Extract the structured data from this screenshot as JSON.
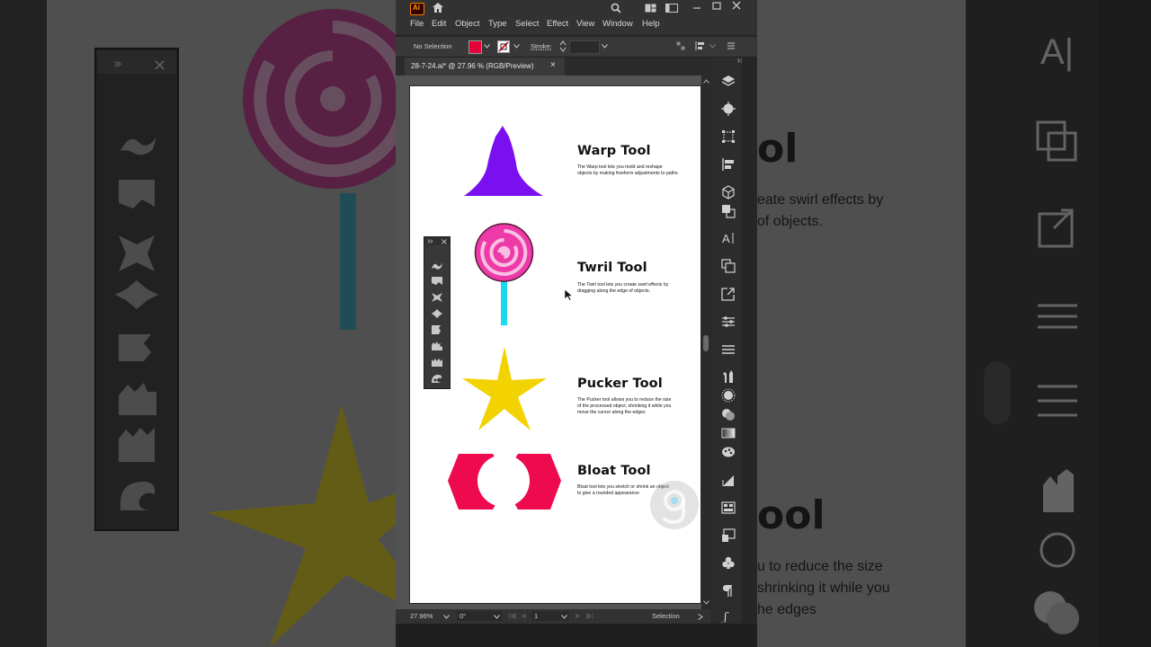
{
  "menu": {
    "items": [
      "File",
      "Edit",
      "Object",
      "Type",
      "Select",
      "Effect",
      "View",
      "Window",
      "Help"
    ]
  },
  "app": {
    "logo": "Ai"
  },
  "control_bar": {
    "selection_label": "No Selection",
    "stroke_label": "Stroke:",
    "fill_color": "#e5003a"
  },
  "document": {
    "tab_title": "28-7-24.ai* @ 27.96 % (RGB/Preview)",
    "close_glyph": "×"
  },
  "artboard": {
    "sections": [
      {
        "heading": "Warp Tool",
        "desc": [
          "The Warp tool lets you mold and reshape",
          "objects by making freeform adjustments to paths."
        ],
        "color": "#7a10f0"
      },
      {
        "heading": "Twril Tool",
        "desc": [
          "The Twirl tool lets you create swirl effects by",
          "dragging along the edge of objects."
        ],
        "color": "#ee3aa8"
      },
      {
        "heading": "Pucker Tool",
        "desc": [
          "The Pucker tool allows you to reduce the size",
          "of the processed object, shrinking it while you",
          "move the cursor along the edges"
        ],
        "color": "#f2d200"
      },
      {
        "heading": "Bloat Tool",
        "desc": [
          "Bloat tool lets you stretch or shrink an object",
          "to give a rounded appearance"
        ],
        "color": "#ee0a4e"
      }
    ]
  },
  "status_bar": {
    "zoom": "27.96%",
    "rotation": "0°",
    "artboard_number": "1",
    "tool_name": "Selection"
  },
  "background_text": {
    "right_heading_top": "ol",
    "right_desc_top": [
      "eate swirl effects by",
      "of objects."
    ],
    "right_heading_bottom": "ool",
    "right_desc_bottom": [
      "u to reduce the size",
      "shrinking it while you",
      "he edges"
    ],
    "right_panel_label": "A|"
  },
  "icons": {
    "floating_panel_tools": [
      "warp-tool-icon",
      "twirl-tool-icon",
      "pucker-tool-icon",
      "bloat-tool-icon",
      "scallop-tool-icon",
      "crystallize-tool-icon",
      "wrinkle-tool-icon",
      "width-tool-icon"
    ],
    "right_panel": [
      "layers-icon",
      "appearance-icon",
      "transform-icon",
      "align-icon",
      "3d-icon",
      "pathfinder-icon",
      "character-icon",
      "artboards-icon",
      "export-icon",
      "properties-icon",
      "menu-icon",
      "symbols-icon",
      "brushes-icon",
      "color-icon",
      "gradient-icon",
      "swatches-icon",
      "graphic-styles-icon",
      "libraries-icon",
      "asset-export-icon",
      "club-icon",
      "paragraph-icon",
      "glyphs-icon"
    ]
  }
}
